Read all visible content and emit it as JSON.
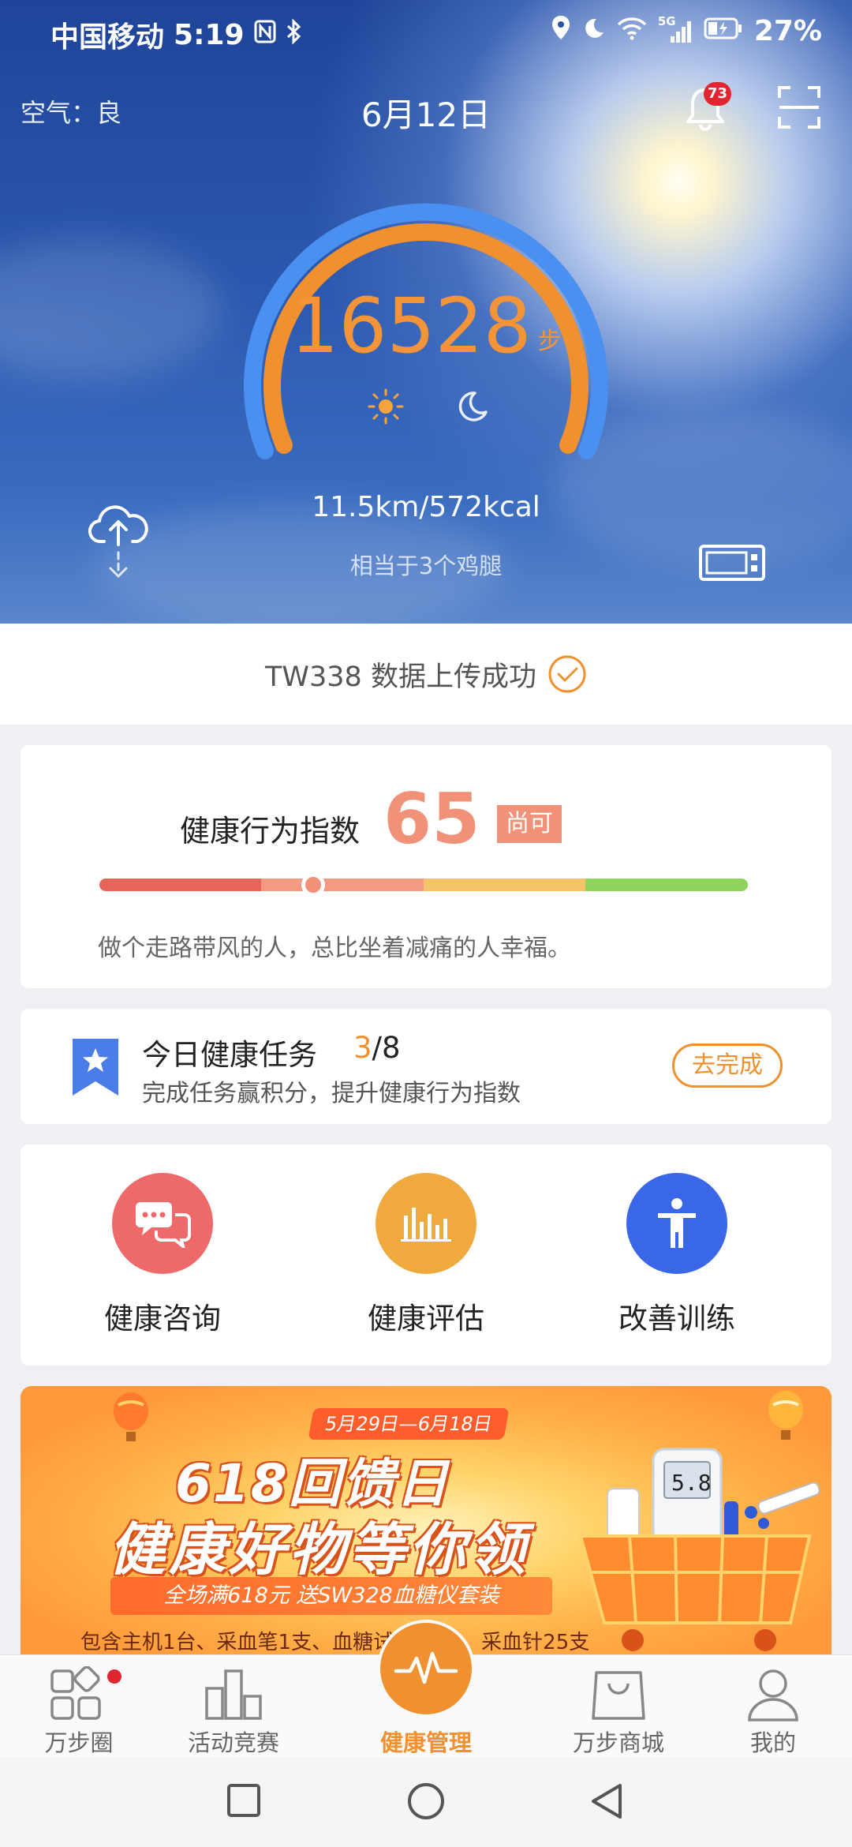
{
  "status_bar": {
    "carrier": "中国移动",
    "time": "5:19",
    "battery": "27%",
    "network": "5G"
  },
  "header": {
    "air_quality": "空气：良",
    "date": "6月12日",
    "notification_count": "73"
  },
  "steps": {
    "count": "16528",
    "unit": "步",
    "distance_calories": "11.5km/572kcal",
    "equivalent": "相当于3个鸡腿",
    "colors": {
      "outer_ring": "#4a90f0",
      "inner_ring": "#f0902e"
    }
  },
  "upload": {
    "message": "TW338 数据上传成功"
  },
  "health_index": {
    "label": "健康行为指数",
    "value": "65",
    "rating": "尚可",
    "level": 0.33,
    "quote": "做个走路带风的人，总比坐着减痛的人幸福。",
    "colors": [
      "#e5655b",
      "#f49a82",
      "#f4c46a",
      "#8ed35c"
    ]
  },
  "task": {
    "title": "今日健康任务",
    "done": "3",
    "total": "/8",
    "subtitle": "完成任务赢积分，提升健康行为指数",
    "button": "去完成"
  },
  "services": [
    {
      "label": "健康咨询",
      "icon": "chat-bubbles-icon",
      "color": "#ee6a6a"
    },
    {
      "label": "健康评估",
      "icon": "bar-chart-icon",
      "color": "#f0a93c"
    },
    {
      "label": "改善训练",
      "icon": "person-stretch-icon",
      "color": "#3a66e8"
    }
  ],
  "banner": {
    "date_range": "5月29日—6月18日",
    "title1": "618回馈日",
    "title2": "健康好物等你领",
    "ribbon": "全场满618元 送SW328血糖仪套装",
    "sub": "包含主机1台、采血笔1支、血糖试纸25片、采血针25支",
    "meter_reading": "5.8"
  },
  "tabbar": {
    "items": [
      {
        "label": "万步圈",
        "icon": "community-grid-icon"
      },
      {
        "label": "活动竞赛",
        "icon": "leaderboard-icon"
      },
      {
        "label": "健康管理",
        "icon": "heartbeat-icon"
      },
      {
        "label": "万步商城",
        "icon": "shopping-bag-icon"
      },
      {
        "label": "我的",
        "icon": "profile-icon"
      }
    ],
    "active_index": 2
  }
}
